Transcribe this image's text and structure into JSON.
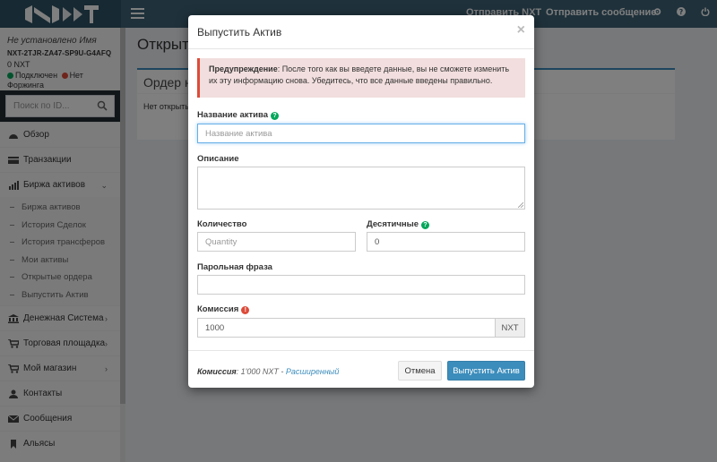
{
  "topbar": {
    "nav_links": [
      "Отправить NXT",
      "Отправить сообщение"
    ],
    "icons": [
      "gear-icon",
      "question-icon",
      "power-icon"
    ]
  },
  "sidebar": {
    "user": {
      "name": "Не установлено Имя",
      "account": "NXT-2TJR-ZA47-SP9U-G4AFQ",
      "balance": "0 NXT",
      "connected": "Подключен",
      "forging": "Нет Форжинга"
    },
    "search_placeholder": "Поиск по ID...",
    "menu": [
      {
        "label": "Обзор",
        "icon": "dashboard-icon"
      },
      {
        "label": "Транзакции",
        "icon": "transactions-icon"
      },
      {
        "label": "Биржа активов",
        "icon": "bar-chart-icon",
        "expanded": true
      }
    ],
    "submenu": [
      "Биржа активов",
      "История Сделок",
      "История трансферов",
      "Мои активы",
      "Открытые ордера",
      "Выпустить Актив"
    ],
    "menu_after": [
      {
        "label": "Денежная Система",
        "icon": "bank-icon"
      },
      {
        "label": "Торговая площадка",
        "icon": "cart-icon"
      },
      {
        "label": "Мой магазин",
        "icon": "store-icon"
      },
      {
        "label": "Контакты",
        "icon": "user-icon"
      },
      {
        "label": "Сообщения",
        "icon": "envelope-icon"
      },
      {
        "label": "Альясы",
        "icon": "bookmark-icon"
      }
    ]
  },
  "content": {
    "page_title": "Открытые ордера",
    "box_title": "Ордер на покупку",
    "box_text": "Нет открытых ордеров на покупку."
  },
  "modal": {
    "title": "Выпустить Актив",
    "close": "×",
    "warning_strong": "Предупреждение",
    "warning_text": ": После того как вы введете данные, вы не сможете изменить их эту информацию снова. Убедитесь, что все данные введены правильно.",
    "name_label": "Название актива",
    "name_placeholder": "Название актива",
    "description_label": "Описание",
    "quantity_label": "Количество",
    "quantity_placeholder": "Quantity",
    "decimals_label": "Десятичные",
    "decimals_value": "0",
    "passphrase_label": "Парольная фраза",
    "fee_label": "Комиссия",
    "fee_value": "1000",
    "fee_unit": "NXT",
    "footer_fee_label": "Комиссия",
    "footer_fee_value": ": 1'000 NXT - ",
    "footer_advanced": "Расширенный",
    "cancel_label": "Отмена",
    "submit_label": "Выпустить Актив"
  },
  "colors": {
    "navbar": "#3e6376",
    "primary": "#3c8dbc",
    "danger": "#dd4b39",
    "success": "#00a65a",
    "warning_bg": "#f2dede"
  }
}
